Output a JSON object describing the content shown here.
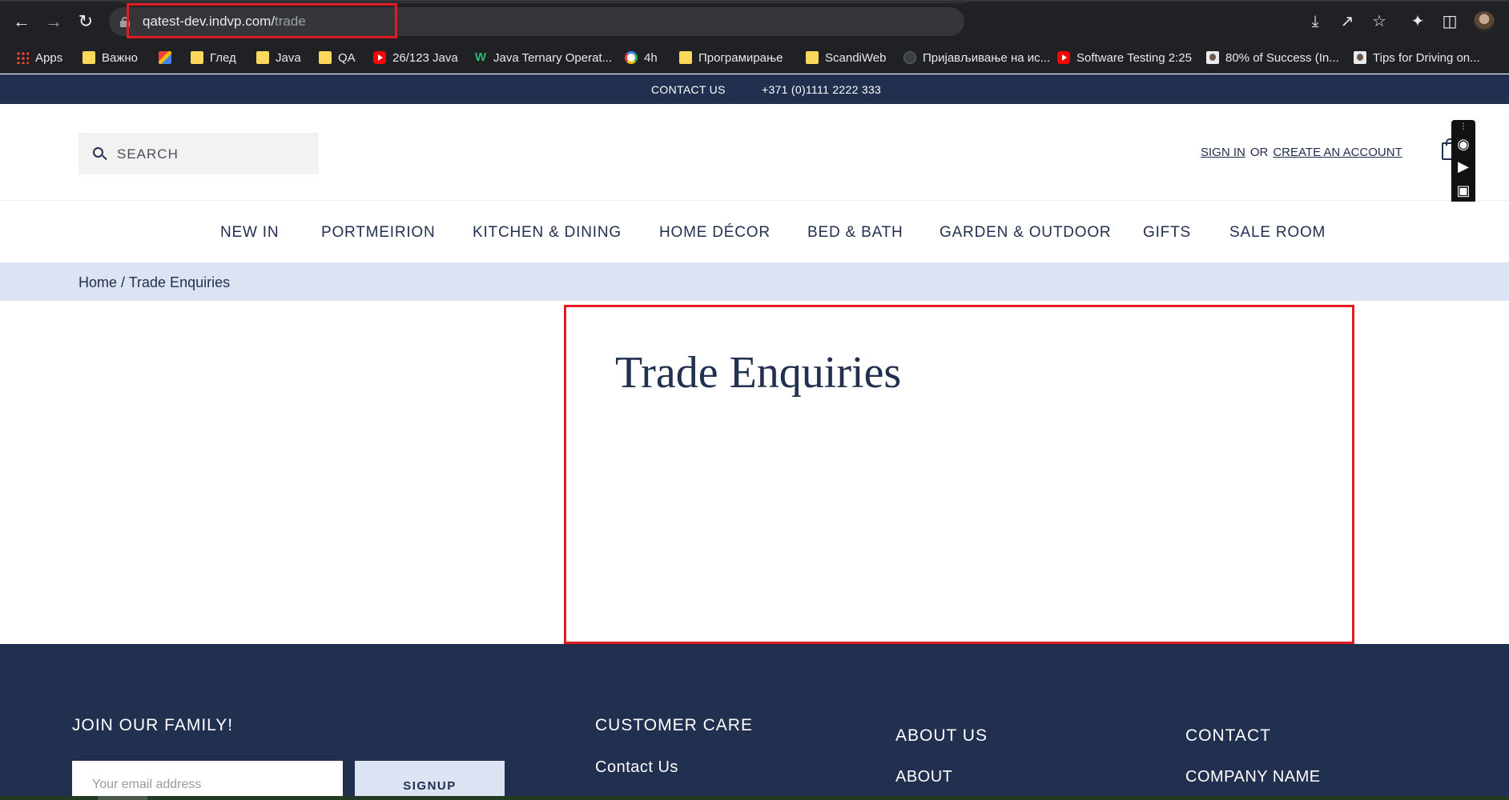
{
  "browser": {
    "url_host": "qatest-dev.indvp.com/",
    "url_path": "trade",
    "bookmarks": [
      {
        "label": "Apps",
        "icon": "apps-grid-icon"
      },
      {
        "label": "Важно",
        "icon": "folder-icon"
      },
      {
        "label": "",
        "icon": "gmail-icon"
      },
      {
        "label": "Глед",
        "icon": "folder-icon"
      },
      {
        "label": "Java",
        "icon": "folder-icon"
      },
      {
        "label": "QA",
        "icon": "folder-icon"
      },
      {
        "label": "26/123 Java",
        "icon": "youtube-icon"
      },
      {
        "label": "Java Ternary Operat...",
        "icon": "w-icon"
      },
      {
        "label": "4h",
        "icon": "google-icon"
      },
      {
        "label": "Програмирање",
        "icon": "folder-icon"
      },
      {
        "label": "ScandiWeb",
        "icon": "folder-icon"
      },
      {
        "label": "Пријављивање на ис...",
        "icon": "circle-icon"
      },
      {
        "label": "Software Testing 2:25",
        "icon": "youtube-icon"
      },
      {
        "label": "80% of Success (In...",
        "icon": "thumbnail-icon"
      },
      {
        "label": "Tips for Driving on...",
        "icon": "thumbnail-icon"
      }
    ]
  },
  "topbar": {
    "contact": "CONTACT US",
    "phone": "+371 (0)1111 2222 333"
  },
  "header": {
    "search_label": "SEARCH",
    "sign_in": "SIGN IN",
    "or": "OR",
    "create_account": "CREATE AN ACCOUNT"
  },
  "nav": {
    "items": [
      "NEW IN",
      "PORTMEIRION",
      "KITCHEN & DINING",
      "HOME DÉCOR",
      "BED & BATH",
      "GARDEN & OUTDOOR",
      "GIFTS",
      "SALE ROOM"
    ]
  },
  "breadcrumb": {
    "home": "Home",
    "separator": " / ",
    "current": "Trade Enquiries"
  },
  "main": {
    "title": "Trade Enquiries"
  },
  "footer": {
    "join_heading": "JOIN OUR FAMILY!",
    "email_placeholder": "Your email address",
    "signup_label": "SIGNUP",
    "customer_care_heading": "CUSTOMER CARE",
    "contact_us_link": "Contact Us",
    "about_heading": "ABOUT US",
    "about_link": "ABOUT",
    "contact_heading": "CONTACT",
    "company_name": "COMPANY NAME"
  },
  "colors": {
    "navy": "#223050",
    "breadcrumb_bg": "#dce3f2",
    "highlight_red": "#e11b22"
  }
}
